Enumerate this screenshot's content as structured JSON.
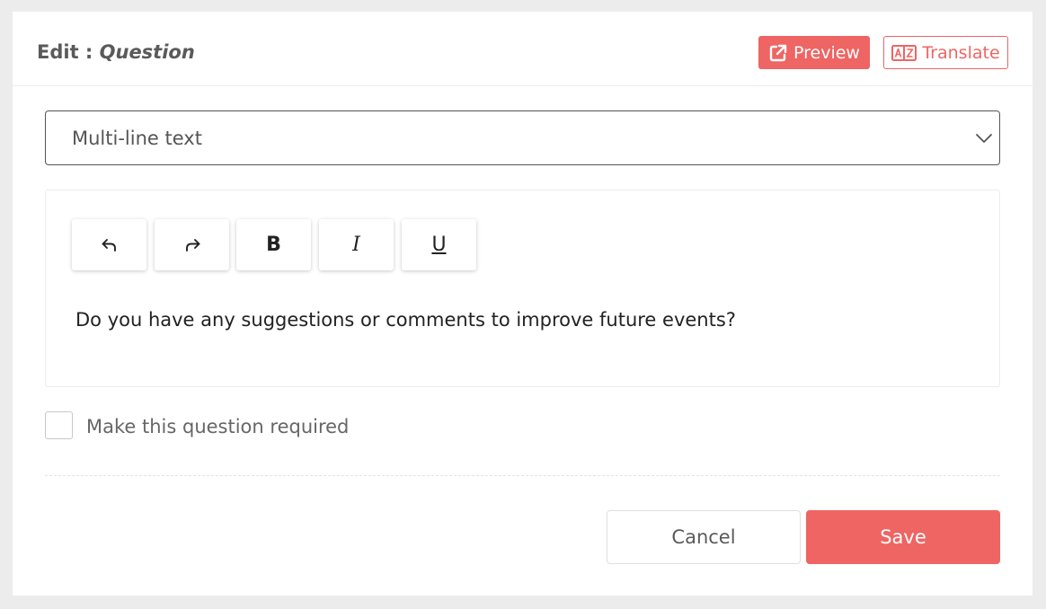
{
  "header": {
    "title_prefix": "Edit : ",
    "title_entity": "Question",
    "preview_label": "Preview",
    "translate_label": "Translate",
    "preview_icon": "external-link-icon",
    "translate_icon": "translate-icon"
  },
  "question_type": {
    "selected": "Multi-line text",
    "icon": "chevron-down-icon"
  },
  "editor": {
    "toolbar": {
      "undo_icon": "undo-icon",
      "redo_icon": "redo-icon",
      "bold_label": "B",
      "italic_label": "I",
      "underline_label": "U"
    },
    "content": "Do you have any suggestions or comments to improve future events?"
  },
  "required": {
    "label": "Make this question required",
    "checked": false
  },
  "footer": {
    "cancel_label": "Cancel",
    "save_label": "Save"
  },
  "colors": {
    "accent": "#ee6563",
    "text": "#5a5a5a",
    "background": "#ececec"
  }
}
